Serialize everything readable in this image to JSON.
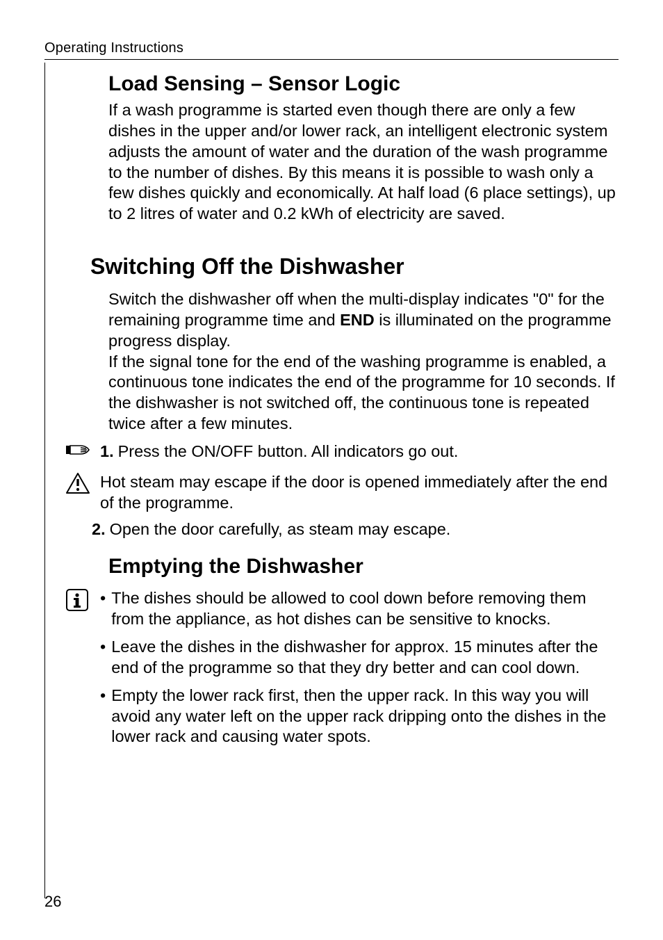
{
  "running_head": "Operating Instructions",
  "section1": {
    "title": "Load Sensing – Sensor Logic",
    "body": "If a wash programme is started even though there are only a few dishes in the upper and/or lower rack, an intelligent electronic system adjusts the amount of water and the duration of the wash programme to the number of dishes. By this means it is possible to wash only a few dishes quickly and economically. At half load (6 place settings), up to 2 litres of water and 0.2 kWh of electricity are saved."
  },
  "section2": {
    "title": "Switching Off the Dishwasher",
    "body_a": "Switch the dishwasher off when the multi-display indicates \"0\" for the remaining programme time and ",
    "body_bold": "END",
    "body_b": " is illuminated on the programme progress display.",
    "body2": "If the signal tone for the end of the washing programme is enabled, a continuous tone indicates the end of the programme for 10 seconds. If the dishwasher is not switched off, the continuous tone is repeated twice after a few minutes.",
    "step1_num": "1.",
    "step1_text": "Press the ON/OFF button. All indicators go out.",
    "warning": "Hot steam may escape if the door is opened immediately after the end of the programme.",
    "step2_num": "2.",
    "step2_text": "Open the door carefully, as steam may escape."
  },
  "section3": {
    "title": "Emptying the Dishwasher",
    "bullets": [
      "The dishes should be allowed to cool down before removing them from the appliance, as hot dishes can be sensitive to knocks.",
      "Leave the dishes in the dishwasher for approx. 15 minutes after the end of the programme so that they dry better and can cool down.",
      "Empty the lower rack first, then the upper rack. In this way you will avoid any water left on the upper rack dripping onto the dishes in the lower rack and causing water spots."
    ]
  },
  "page_number": "26"
}
